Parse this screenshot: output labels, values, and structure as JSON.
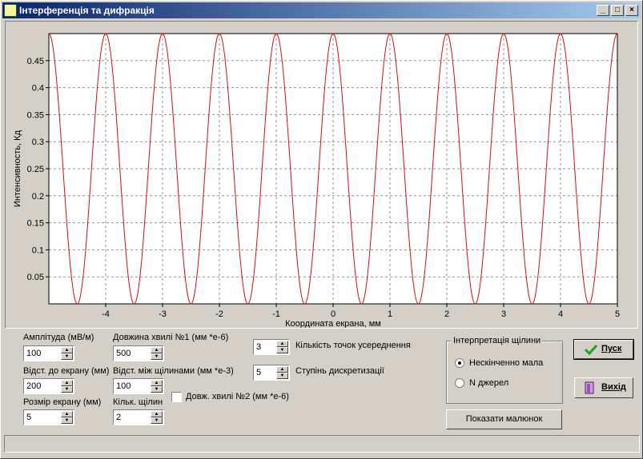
{
  "window": {
    "title": "Інтерференція та дифракція",
    "minimize_glyph": "_",
    "maximize_glyph": "□",
    "close_glyph": "×"
  },
  "chart_data": {
    "type": "line",
    "title": "",
    "xlabel": "Координата екрана, мм",
    "ylabel": "Интенсивность, Кд",
    "xlim": [
      -5,
      5
    ],
    "ylim": [
      0,
      0.5
    ],
    "x_ticks": [
      "-4",
      "-3",
      "-2",
      "-1",
      "0",
      "1",
      "2",
      "3",
      "4",
      "5"
    ],
    "y_ticks": [
      "0.05",
      "0.1",
      "0.15",
      "0.2",
      "0.25",
      "0.3",
      "0.35",
      "0.4",
      "0.45"
    ],
    "grid": true,
    "series": [
      {
        "color": "#d01010",
        "x": [
          -5,
          -4.75,
          -4.5,
          -4.25,
          -4,
          -3.75,
          -3.5,
          -3.25,
          -3,
          -2.75,
          -2.5,
          -2.25,
          -2,
          -1.75,
          -1.5,
          -1.25,
          -1,
          -0.75,
          -0.5,
          -0.25,
          0,
          0.25,
          0.5,
          0.75,
          1,
          1.25,
          1.5,
          1.75,
          2,
          2.25,
          2.5,
          2.75,
          3,
          3.25,
          3.5,
          3.75,
          4,
          4.25,
          4.5,
          4.75,
          5
        ],
        "y": [
          0.5,
          0.25,
          0,
          0.25,
          0.5,
          0.25,
          0,
          0.25,
          0.5,
          0.25,
          0,
          0.25,
          0.5,
          0.25,
          0,
          0.25,
          0.5,
          0.25,
          0,
          0.25,
          0.5,
          0.25,
          0,
          0.25,
          0.5,
          0.25,
          0,
          0.25,
          0.5,
          0.25,
          0,
          0.25,
          0.5,
          0.25,
          0,
          0.25,
          0.5,
          0.25,
          0,
          0.25,
          0.5
        ]
      }
    ]
  },
  "controls": {
    "amplitude": {
      "label": "Амплітуда (мВ/м)",
      "value": "100"
    },
    "distance_screen": {
      "label": "Відст. до екрану (мм)",
      "value": "200"
    },
    "screen_size": {
      "label": "Розмір екрану (мм)",
      "value": "5"
    },
    "wavelength1": {
      "label": "Довжина хвилі №1 (мм *е-6)",
      "value": "500"
    },
    "slit_distance": {
      "label": "Відст. між щілинами (мм *е-3)",
      "value": "100"
    },
    "slit_count": {
      "label": "Кільк. щілин",
      "value": "2"
    },
    "wavelength2_checkbox": {
      "label": "Довж. хвилі №2 (мм *е-6)",
      "checked": false
    },
    "avg_points": {
      "label": "Кількість точок усереднення",
      "value": "3"
    },
    "discretization": {
      "label": "Ступінь дискретизації",
      "value": "5"
    }
  },
  "slit_group": {
    "title": "Інтерпретація щілини",
    "options": [
      "Нескінченно мала",
      "N  джерел"
    ],
    "selected": 0
  },
  "buttons": {
    "start": "Пуск",
    "exit": "Вихід",
    "show_picture": "Показати малюнок"
  },
  "icons": {
    "spin_up": "▲",
    "spin_down": "▼"
  }
}
